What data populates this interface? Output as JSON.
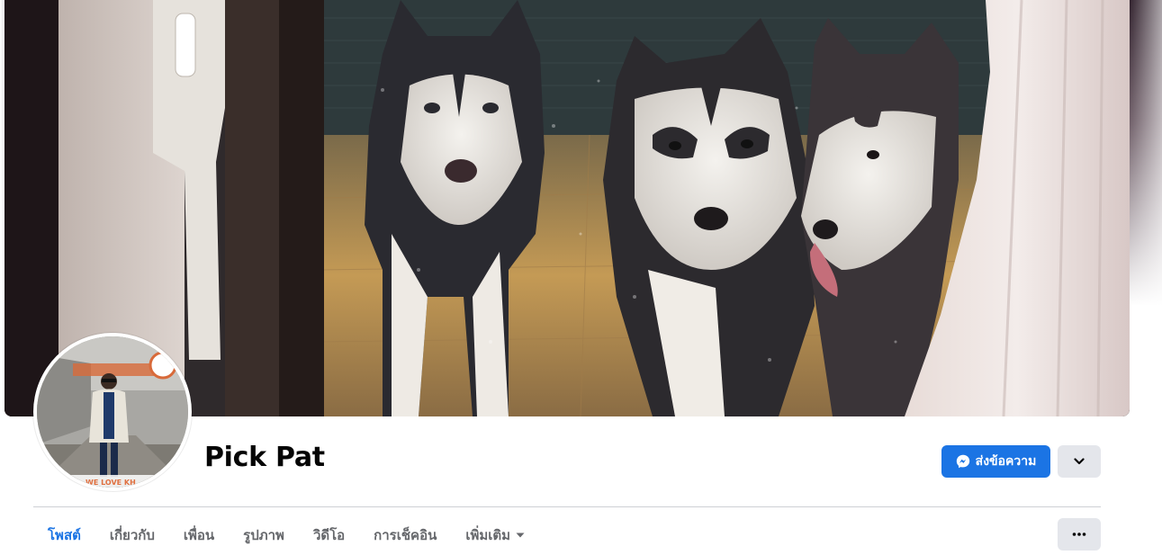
{
  "profile": {
    "name": "Pick Pat",
    "avatar_banner_text": "WE LOVE KH"
  },
  "actions": {
    "message_label": "ส่งข้อความ",
    "message_icon": "messenger-icon",
    "more_actions_icon": "chevron-down-icon",
    "ellipsis_icon": "ellipsis-icon"
  },
  "tabs": [
    {
      "label": "โพสต์",
      "active": true
    },
    {
      "label": "เกี่ยวกับ",
      "active": false
    },
    {
      "label": "เพื่อน",
      "active": false
    },
    {
      "label": "รูปภาพ",
      "active": false
    },
    {
      "label": "วิดีโอ",
      "active": false
    },
    {
      "label": "การเช็คอิน",
      "active": false
    },
    {
      "label": "เพิ่มเติม",
      "active": false,
      "has_dropdown": true
    }
  ],
  "colors": {
    "accent": "#1b74e4",
    "button_gray": "#e4e6eb",
    "text_primary": "#050505",
    "text_secondary": "#65676b",
    "divider": "#ced0d4"
  }
}
